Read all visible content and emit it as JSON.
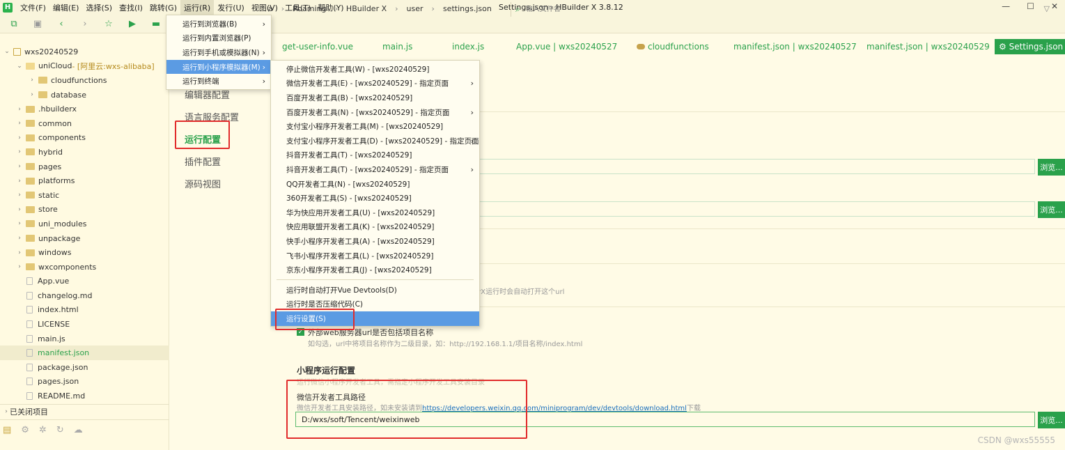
{
  "app": {
    "window_title": "Settings.json - HBuilder X 3.8.12",
    "logo_letter": "H",
    "menus": [
      "文件(F)",
      "编辑(E)",
      "选择(S)",
      "查找(I)",
      "跳转(G)",
      "运行(R)",
      "发行(U)",
      "视图(V)",
      "工具(T)",
      "帮助(Y)"
    ],
    "active_menu_index": 5
  },
  "toolbar": {
    "breadcrumb": [
      "a",
      "Roaming",
      "HBuilder X",
      "user",
      "settings.json"
    ],
    "file_search_placeholder": "输入文件名"
  },
  "sidebar": {
    "tree": [
      {
        "label": "wxs20240529",
        "indent": 0,
        "icon": "project",
        "arrow": "down"
      },
      {
        "label": "uniCloud",
        "suffix": " - [阿里云:wxs-alibaba]",
        "indent": 1,
        "icon": "cloud-folder",
        "arrow": "down"
      },
      {
        "label": "cloudfunctions",
        "indent": 2,
        "icon": "folder",
        "arrow": "right"
      },
      {
        "label": "database",
        "indent": 2,
        "icon": "folder",
        "arrow": "right"
      },
      {
        "label": ".hbuilderx",
        "indent": 1,
        "icon": "folder",
        "arrow": "right"
      },
      {
        "label": "common",
        "indent": 1,
        "icon": "folder",
        "arrow": "right"
      },
      {
        "label": "components",
        "indent": 1,
        "icon": "folder",
        "arrow": "right"
      },
      {
        "label": "hybrid",
        "indent": 1,
        "icon": "folder",
        "arrow": "right"
      },
      {
        "label": "pages",
        "indent": 1,
        "icon": "folder",
        "arrow": "right"
      },
      {
        "label": "platforms",
        "indent": 1,
        "icon": "folder",
        "arrow": "right"
      },
      {
        "label": "static",
        "indent": 1,
        "icon": "folder",
        "arrow": "right"
      },
      {
        "label": "store",
        "indent": 1,
        "icon": "folder",
        "arrow": "right"
      },
      {
        "label": "uni_modules",
        "indent": 1,
        "icon": "folder",
        "arrow": "right"
      },
      {
        "label": "unpackage",
        "indent": 1,
        "icon": "folder",
        "arrow": "right"
      },
      {
        "label": "windows",
        "indent": 1,
        "icon": "folder",
        "arrow": "right"
      },
      {
        "label": "wxcomponents",
        "indent": 1,
        "icon": "folder",
        "arrow": "right"
      },
      {
        "label": "App.vue",
        "indent": 1,
        "icon": "file",
        "arrow": ""
      },
      {
        "label": "changelog.md",
        "indent": 1,
        "icon": "file",
        "arrow": ""
      },
      {
        "label": "index.html",
        "indent": 1,
        "icon": "file",
        "arrow": ""
      },
      {
        "label": "LICENSE",
        "indent": 1,
        "icon": "file",
        "arrow": ""
      },
      {
        "label": "main.js",
        "indent": 1,
        "icon": "file",
        "arrow": ""
      },
      {
        "label": "manifest.json",
        "indent": 1,
        "icon": "file",
        "arrow": "",
        "selected": true
      },
      {
        "label": "package.json",
        "indent": 1,
        "icon": "file",
        "arrow": ""
      },
      {
        "label": "pages.json",
        "indent": 1,
        "icon": "file",
        "arrow": ""
      },
      {
        "label": "README.md",
        "indent": 1,
        "icon": "file",
        "arrow": ""
      }
    ],
    "closed_projects": "已关闭项目"
  },
  "editor_tabs": [
    "get-user-info.vue",
    "main.js",
    "index.js",
    "App.vue | wxs20240527",
    "cloudfunctions",
    "manifest.json | wxs20240527",
    "manifest.json | wxs20240529",
    "Settings.json"
  ],
  "settings_nav": [
    "编辑器配置",
    "语言服务配置",
    "运行配置",
    "插件配置",
    "源码视图"
  ],
  "settings_nav_active": "运行配置",
  "run_menu": {
    "items": [
      {
        "label": "运行到浏览器(B)",
        "submenu": true
      },
      {
        "label": "运行到内置浏览器(P)",
        "submenu": false
      },
      {
        "label": "运行到手机或模拟器(N)",
        "submenu": true
      },
      {
        "label": "运行到小程序模拟器(M)",
        "submenu": true,
        "highlight": true
      },
      {
        "label": "运行到终端",
        "submenu": true
      }
    ]
  },
  "miniprogram_menu": {
    "items": [
      {
        "label": "停止微信开发者工具(W) - [wxs20240529]",
        "submenu": false
      },
      {
        "label": "微信开发者工具(E) - [wxs20240529] - 指定页面",
        "submenu": true
      },
      {
        "label": "百度开发者工具(B) - [wxs20240529]",
        "submenu": false
      },
      {
        "label": "百度开发者工具(N) - [wxs20240529] - 指定页面",
        "submenu": true
      },
      {
        "label": "支付宝小程序开发者工具(M) - [wxs20240529]",
        "submenu": false
      },
      {
        "label": "支付宝小程序开发者工具(D) - [wxs20240529] - 指定页面",
        "submenu": true
      },
      {
        "label": "抖音开发者工具(T) - [wxs20240529]",
        "submenu": false
      },
      {
        "label": "抖音开发者工具(T) - [wxs20240529] - 指定页面",
        "submenu": true
      },
      {
        "label": "QQ开发者工具(N) - [wxs20240529]",
        "submenu": false
      },
      {
        "label": "360开发者工具(S) - [wxs20240529]",
        "submenu": false
      },
      {
        "label": "华为快应用开发者工具(U) - [wxs20240529]",
        "submenu": false
      },
      {
        "label": "快应用联盟开发者工具(K) - [wxs20240529]",
        "submenu": false
      },
      {
        "label": "快手小程序开发者工具(A) - [wxs20240529]",
        "submenu": false
      },
      {
        "label": "飞书小程序开发者工具(L) - [wxs20240529]",
        "submenu": false
      },
      {
        "label": "京东小程序开发者工具(J) - [wxs20240529]",
        "submenu": false
      }
    ],
    "extra_items": [
      {
        "label": "运行时自动打开Vue Devtools(D)"
      },
      {
        "label": "运行时是否压缩代码(C)"
      },
      {
        "label": "运行设置(S)",
        "highlight": true
      }
    ]
  },
  "content": {
    "browse_label": "浏览...",
    "url_hint_fragment": "erX运行时会自动打开这个url",
    "checkbox_label": "外部web服务器url是否包括项目名称",
    "checkbox_hint": "如勾选，url中将项目名称作为二级目录，如：http://192.168.1.1/项目名称/index.html",
    "mp_section_title": "小程序运行配置",
    "mp_section_subtitle": "运行微信小程序开发者工具，需指定小程序开发工具安装目录",
    "wechat_path_label": "微信开发者工具路径",
    "wechat_hint_prefix": "微信开发者工具安装路径，如未安装请到",
    "wechat_hint_link": "https://developers.weixin.qq.com/miniprogram/dev/devtools/download.html",
    "wechat_hint_suffix": "下载",
    "wechat_path_value": "D:/wxs/soft/Tencent/weixinweb"
  },
  "watermark": "CSDN @wxs55555",
  "colors": {
    "accent": "#2aa14b",
    "highlight": "#5b9be3",
    "annotation": "#e12b2b",
    "background": "#fffbe6"
  }
}
